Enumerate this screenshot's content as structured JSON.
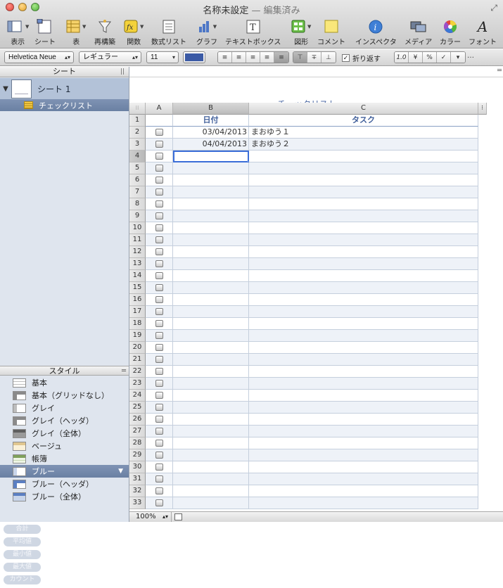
{
  "window": {
    "title": "名称未設定",
    "separator": "—",
    "status": "編集済み"
  },
  "toolbar": [
    {
      "key": "view",
      "label": "表示",
      "icon": "view-icon",
      "has_menu": true
    },
    {
      "key": "sheet",
      "label": "シート",
      "icon": "sheet-icon",
      "has_menu": false
    },
    {
      "key": "table",
      "label": "表",
      "icon": "table-icon",
      "has_menu": true
    },
    {
      "key": "reorganize",
      "label": "再構築",
      "icon": "reorganize-funnel-icon",
      "has_menu": false
    },
    {
      "key": "function",
      "label": "関数",
      "icon": "function-fx-icon",
      "has_menu": true
    },
    {
      "key": "formula-list",
      "label": "数式リスト",
      "icon": "formula-list-icon",
      "has_menu": false
    },
    {
      "key": "chart",
      "label": "グラフ",
      "icon": "chart-icon",
      "has_menu": true
    },
    {
      "key": "textbox",
      "label": "テキストボックス",
      "icon": "textbox-icon",
      "has_menu": false
    },
    {
      "key": "shape",
      "label": "図形",
      "icon": "shape-icon",
      "has_menu": true
    },
    {
      "key": "comment",
      "label": "コメント",
      "icon": "comment-icon",
      "has_menu": false
    },
    {
      "key": "inspector",
      "label": "インスペクタ",
      "icon": "inspector-icon",
      "has_menu": false
    },
    {
      "key": "media",
      "label": "メディア",
      "icon": "media-icon",
      "has_menu": false
    },
    {
      "key": "colors",
      "label": "カラー",
      "icon": "color-wheel-icon",
      "has_menu": false
    },
    {
      "key": "fonts",
      "label": "フォント",
      "icon": "font-icon",
      "has_menu": false
    }
  ],
  "format_bar": {
    "font_family": "Helvetica Neue",
    "font_style": "レギュラー",
    "font_size": "11",
    "text_color": "#3b5aa5",
    "wrap_label": "折り返す",
    "wrap_checked": true,
    "number_formats": [
      "1.0",
      "¥",
      "%",
      "✓",
      "▾"
    ],
    "overflow": "…"
  },
  "sidebar": {
    "sheets_header": "シート",
    "sheet_name": "シート 1",
    "table_name": "チェックリスト",
    "styles_header": "スタイル",
    "styles": [
      {
        "label": "基本",
        "swatch": "basic",
        "selected": false
      },
      {
        "label": "基本（グリッドなし）",
        "swatch": "grayhdr",
        "selected": false
      },
      {
        "label": "グレイ",
        "swatch": "gray",
        "selected": false
      },
      {
        "label": "グレイ（ヘッダ）",
        "swatch": "grayhdr",
        "selected": false
      },
      {
        "label": "グレイ（全体）",
        "swatch": "grayall",
        "selected": false
      },
      {
        "label": "ベージュ",
        "swatch": "beige",
        "selected": false
      },
      {
        "label": "帳簿",
        "swatch": "ledger",
        "selected": false
      },
      {
        "label": "ブルー",
        "swatch": "blue",
        "selected": true
      },
      {
        "label": "ブルー（ヘッダ）",
        "swatch": "bluehdr",
        "selected": false
      },
      {
        "label": "ブルー（全体）",
        "swatch": "blueall",
        "selected": false
      }
    ],
    "functions": [
      "合計",
      "平均値",
      "最小値",
      "最大値",
      "カウント"
    ]
  },
  "canvas": {
    "table_title": "チェックリスト",
    "columns": [
      "A",
      "B",
      "C"
    ],
    "header": {
      "b": "日付",
      "c": "タスク"
    },
    "rows": [
      {
        "date": "03/04/2013",
        "task": "まおゆう１"
      },
      {
        "date": "04/04/2013",
        "task": "まおゆう２"
      }
    ],
    "total_rows": 33,
    "selected_row": 4,
    "selected_column": "B"
  },
  "bottom": {
    "zoom": "100%"
  }
}
